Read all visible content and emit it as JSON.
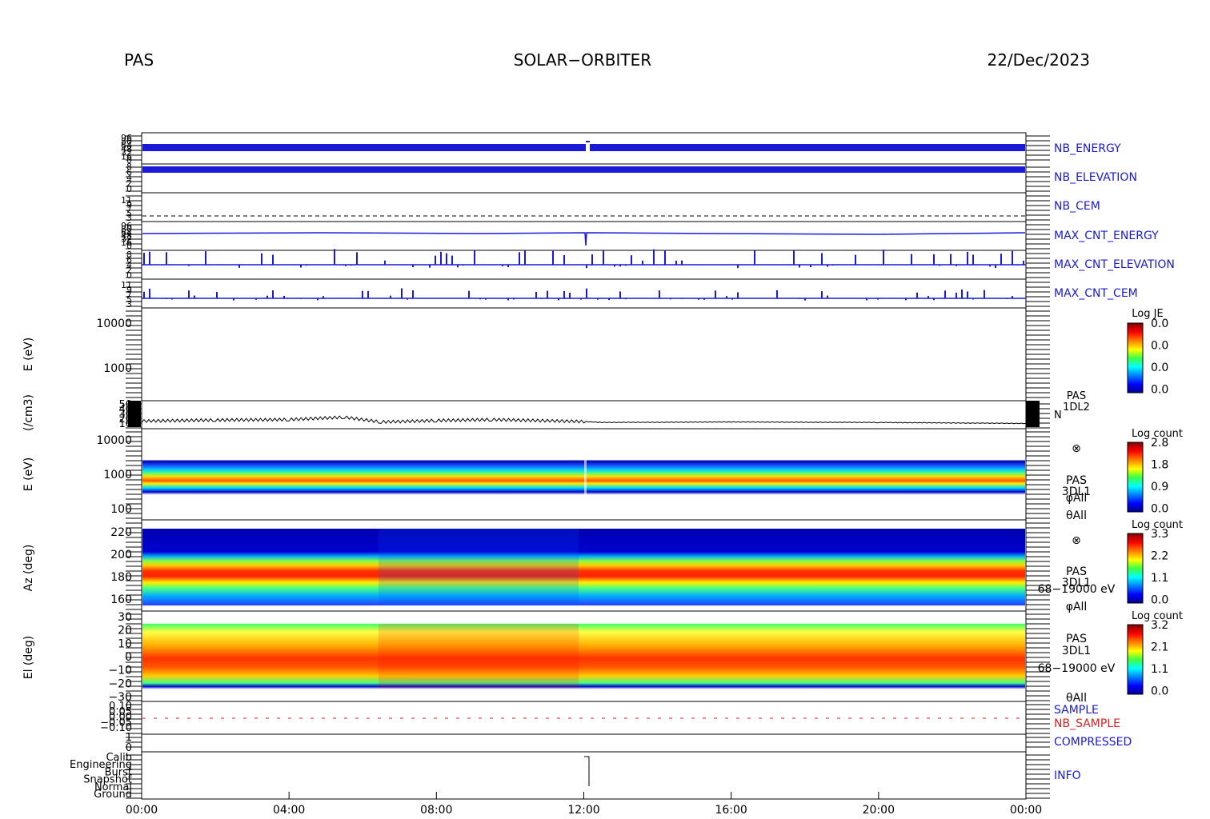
{
  "header": {
    "instrument": "PAS",
    "mission": "SOLAR−ORBITER",
    "date": "22/Dec/2023"
  },
  "x_ticks": [
    "00:00",
    "04:00",
    "08:00",
    "12:00",
    "16:00",
    "20:00",
    "00:00"
  ],
  "colors": {
    "blue": "#1a1ad8",
    "red": "#dd2222",
    "black": "#000000"
  },
  "panels": {
    "nb_energy": {
      "label": "NB_ENERGY",
      "ticks": [
        "96",
        "80",
        "64",
        "48",
        "32",
        "16",
        "0"
      ]
    },
    "nb_elevation": {
      "label": "NB_ELEVATION",
      "ticks": [
        "8",
        "6",
        "4",
        "2",
        "0"
      ]
    },
    "nb_cem": {
      "label": "NB_CEM",
      "ticks": [
        "11",
        "9",
        "7",
        "5",
        "3"
      ]
    },
    "max_cnt_energy": {
      "label": "MAX_CNT_ENERGY",
      "ticks": [
        "96",
        "80",
        "64",
        "48",
        "32",
        "16",
        "0"
      ]
    },
    "max_cnt_elevation": {
      "label": "MAX_CNT_ELEVATION",
      "ticks": [
        "8",
        "6",
        "4",
        "2",
        "0"
      ]
    },
    "max_cnt_cem": {
      "label": "MAX_CNT_CEM",
      "ticks": [
        "11",
        "9",
        "7",
        "5",
        "3"
      ]
    },
    "empty_spec": {
      "ylabel": "E (eV)",
      "ticks": [
        "10000",
        "1000"
      ],
      "cbar_title": "Log JE",
      "cbar_ticks": [
        "0.0",
        "0.0",
        "0.0",
        "0.0"
      ]
    },
    "density": {
      "ylabel": "(/cm3)",
      "ticks": [
        "50",
        "40",
        "30",
        "20",
        "10"
      ],
      "label1": "PAS",
      "label2": "1DL2",
      "label3": "N"
    },
    "energy_spec": {
      "ylabel": "E (eV)",
      "ticks": [
        "10000",
        "1000",
        "100"
      ],
      "cbar_title": "Log count",
      "cbar_ticks": [
        "2.8",
        "1.8",
        "0.9",
        "0.0"
      ],
      "side": [
        "⊗",
        "PAS",
        "3DL1",
        "φAll",
        "θAll"
      ]
    },
    "az_spec": {
      "ylabel": "Az (deg)",
      "ticks": [
        "220",
        "200",
        "180",
        "160"
      ],
      "cbar_title": "Log count",
      "cbar_ticks": [
        "3.3",
        "2.2",
        "1.1",
        "0.0"
      ],
      "side": [
        "⊗",
        "PAS",
        "3DL1",
        "68−19000 eV",
        "φAll"
      ]
    },
    "el_spec": {
      "ylabel": "El (deg)",
      "ticks": [
        "30",
        "20",
        "10",
        "0",
        "−10",
        "−20",
        "−30"
      ],
      "cbar_title": "Log count",
      "cbar_ticks": [
        "3.2",
        "2.1",
        "1.1",
        "0.0"
      ],
      "side": [
        "PAS",
        "3DL1",
        "68−19000 eV",
        "θAll"
      ]
    },
    "sample": {
      "label_sample": "SAMPLE",
      "label_nb": "NB_SAMPLE",
      "ticks": [
        "0.10",
        "0.05",
        "0.00",
        "−0.05",
        "−0.10"
      ]
    },
    "compressed": {
      "label": "COMPRESSED",
      "ticks": [
        "1",
        "0"
      ]
    },
    "info": {
      "label": "INFO",
      "ticks": [
        "Calib",
        "Engineering",
        "Burst",
        "Snapshot",
        "Normal",
        "Ground"
      ]
    }
  },
  "chart_data": {
    "type": "heatmap",
    "x_range": [
      "00:00",
      "24:00"
    ],
    "series": [
      {
        "name": "NB_ENERGY",
        "values": [
          96,
          96
        ],
        "note": "constant band"
      },
      {
        "name": "N",
        "x": [
          "00:00",
          "02:00",
          "04:00",
          "05:30",
          "06:30",
          "08:00",
          "09:30",
          "12:00",
          "12:30",
          "16:00",
          "20:00",
          "24:00"
        ],
        "values": [
          16,
          18,
          19,
          24,
          14,
          17,
          19,
          15,
          13,
          14,
          13,
          11
        ]
      }
    ]
  }
}
